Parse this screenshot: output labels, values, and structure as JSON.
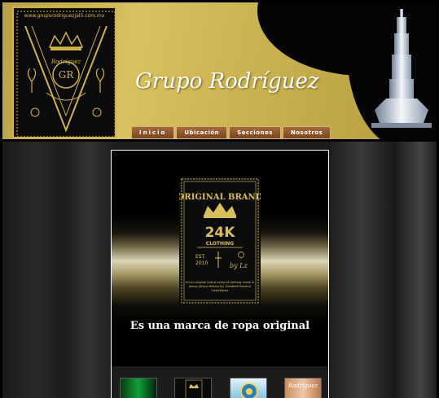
{
  "header": {
    "logo_url": "www.gruporodriguezjal5.com.mx",
    "logo_text": "Rodríguez",
    "logo_monogram": "GR",
    "title": "Grupo Rodríguez"
  },
  "nav": {
    "items": [
      {
        "label": "Inicio"
      },
      {
        "label": "Ubicación"
      },
      {
        "label": "Secciones"
      },
      {
        "label": "Nosotros"
      }
    ]
  },
  "feature": {
    "brand": {
      "title": "ORIGINAL BRAND",
      "name": "24K",
      "sub": "CLOTHING",
      "est": "EST.",
      "year": "2010",
      "by": "by Lz",
      "fine_print": "It's an original brand name of clothing made in Jamay Jalisco México by: Elizabeth Becerra Castellanos"
    },
    "tagline": "Es una marca de ropa original"
  },
  "thumbs": {
    "items": [
      {
        "name": "thumb-green",
        "text": ""
      },
      {
        "name": "thumb-brand",
        "text": ""
      },
      {
        "name": "thumb-seal",
        "text": ""
      },
      {
        "name": "thumb-rodriguez",
        "text": "Rodríguez"
      }
    ]
  },
  "colors": {
    "gold": "#d1b24a",
    "black": "#000000",
    "nav": "#8a5228"
  }
}
